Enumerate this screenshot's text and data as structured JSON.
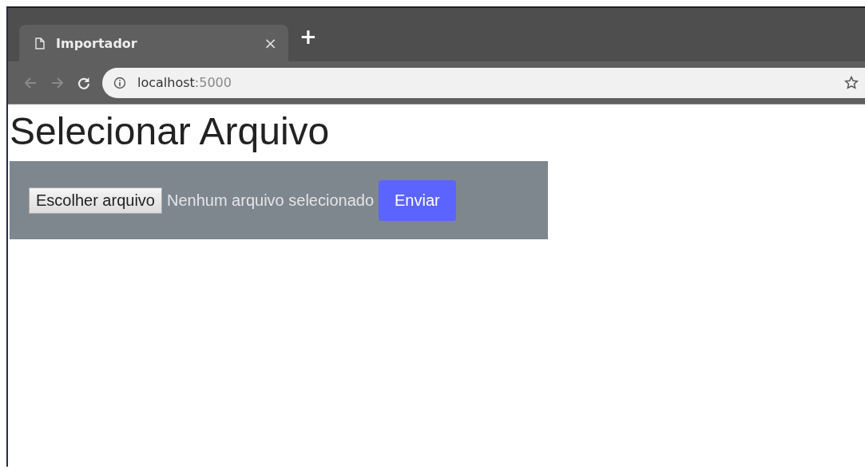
{
  "tabs": [
    {
      "title": "Importador",
      "selected": true,
      "close": "×"
    }
  ],
  "new_tab": "+",
  "address": {
    "host": "localhost",
    "port": ":5000"
  },
  "page": {
    "heading": "Selecionar Arquivo",
    "file_button": "Escolher arquivo",
    "file_status": "Nenhum arquivo selecionado",
    "submit": "Enviar"
  }
}
